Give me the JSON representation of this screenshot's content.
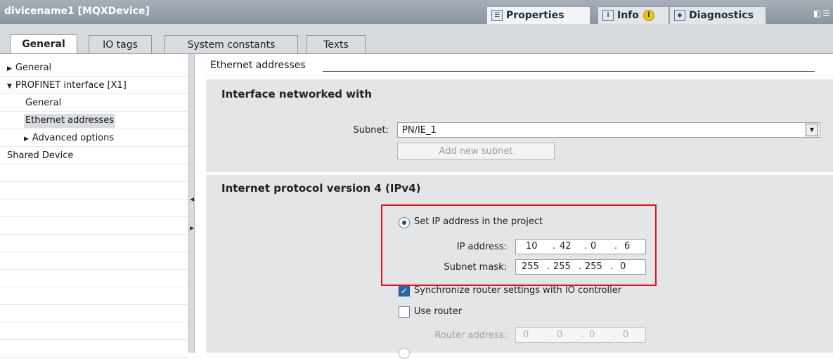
{
  "window": {
    "title": "divicename1 [MQXDevice]",
    "tabs": [
      {
        "label": "Properties",
        "icon": "properties-icon"
      },
      {
        "label": "Info",
        "icon": "info-icon",
        "badge": "i"
      },
      {
        "label": "Diagnostics",
        "icon": "diagnostics-icon"
      }
    ],
    "controls": [
      "restore-icon",
      "menu-icon"
    ]
  },
  "subtabs": [
    "General",
    "IO tags",
    "System constants",
    "Texts"
  ],
  "nav": {
    "items": [
      {
        "label": "General"
      },
      {
        "label": "PROFINET interface [X1]"
      },
      {
        "label": "General"
      },
      {
        "label": "Ethernet addresses"
      },
      {
        "label": "Advanced options"
      },
      {
        "label": "Shared Device"
      }
    ]
  },
  "content": {
    "section_title": "Ethernet addresses",
    "interface_panel": {
      "title": "Interface networked with",
      "subnet_label": "Subnet:",
      "subnet_value": "PN/IE_1",
      "add_subnet_label": "Add new subnet"
    },
    "ipv4_panel": {
      "title": "Internet protocol version 4 (IPv4)",
      "set_ip_label": "Set IP address in the project",
      "ip_label": "IP address:",
      "ip_octets": [
        "10",
        "42",
        "0",
        "6"
      ],
      "mask_label": "Subnet mask:",
      "mask_octets": [
        "255",
        "255",
        "255",
        "0"
      ],
      "sync_label": "Synchronize router settings with IO controller",
      "use_router_label": "Use router",
      "router_label": "Router address:",
      "router_octets": [
        "0",
        "0",
        "0",
        "0"
      ]
    }
  },
  "colors": {
    "highlight_box": "#e0151d",
    "title_bar": "#8b959e",
    "panel_bg": "#e3e5e6"
  }
}
